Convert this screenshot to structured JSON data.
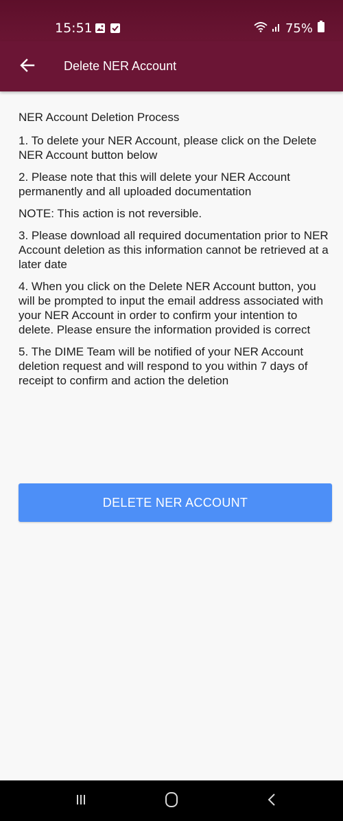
{
  "status_bar": {
    "time": "15:51",
    "battery": "75%"
  },
  "app_bar": {
    "title": "Delete NER Account"
  },
  "content": {
    "heading": "NER Account Deletion Process",
    "step1": "1. To delete your NER Account, please click on the Delete NER Account button below",
    "step2": "2. Please note that this will delete your NER Account permanently and all uploaded documentation",
    "note": "NOTE: This action is not reversible.",
    "step3": "3. Please download all required documentation prior to NER Account deletion as this information cannot be retrieved at a later date",
    "step4": "4. When you click on the Delete NER Account button, you will be prompted to input the email address associated with your NER Account in order to confirm your intention to delete. Please ensure the information provided is correct",
    "step5": "5. The DIME Team will be notified of your NER Account deletion request and will respond to you within 7 days of receipt to confirm and action the deletion"
  },
  "actions": {
    "delete_label": "DELETE NER ACCOUNT"
  },
  "icons": {
    "back": "arrow-left-icon",
    "gallery": "gallery-icon",
    "check": "check-box-icon",
    "wifi": "wifi-icon",
    "signal": "signal-icon",
    "battery": "battery-icon",
    "recents": "recents-icon",
    "home": "home-icon",
    "nav_back": "nav-back-icon"
  },
  "colors": {
    "app_bar": "#6b1535",
    "button": "#4d8ff7",
    "background": "#f8f8f8"
  }
}
